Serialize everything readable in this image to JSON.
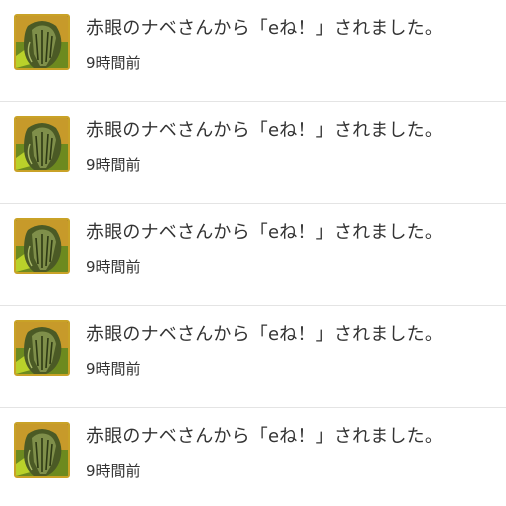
{
  "notifications": [
    {
      "message": "赤眼のナベさんから「eね！」されました。",
      "time": "9時間前",
      "avatar_icon": "green-creature-avatar-icon"
    },
    {
      "message": "赤眼のナベさんから「eね！」されました。",
      "time": "9時間前",
      "avatar_icon": "green-creature-avatar-icon"
    },
    {
      "message": "赤眼のナベさんから「eね！」されました。",
      "time": "9時間前",
      "avatar_icon": "green-creature-avatar-icon"
    },
    {
      "message": "赤眼のナベさんから「eね！」されました。",
      "time": "9時間前",
      "avatar_icon": "green-creature-avatar-icon"
    },
    {
      "message": "赤眼のナベさんから「eね！」されました。",
      "time": "9時間前",
      "avatar_icon": "green-creature-avatar-icon"
    }
  ],
  "colors": {
    "avatar_border": "#c9a227",
    "text": "#333333",
    "divider": "#e4e4e4"
  }
}
